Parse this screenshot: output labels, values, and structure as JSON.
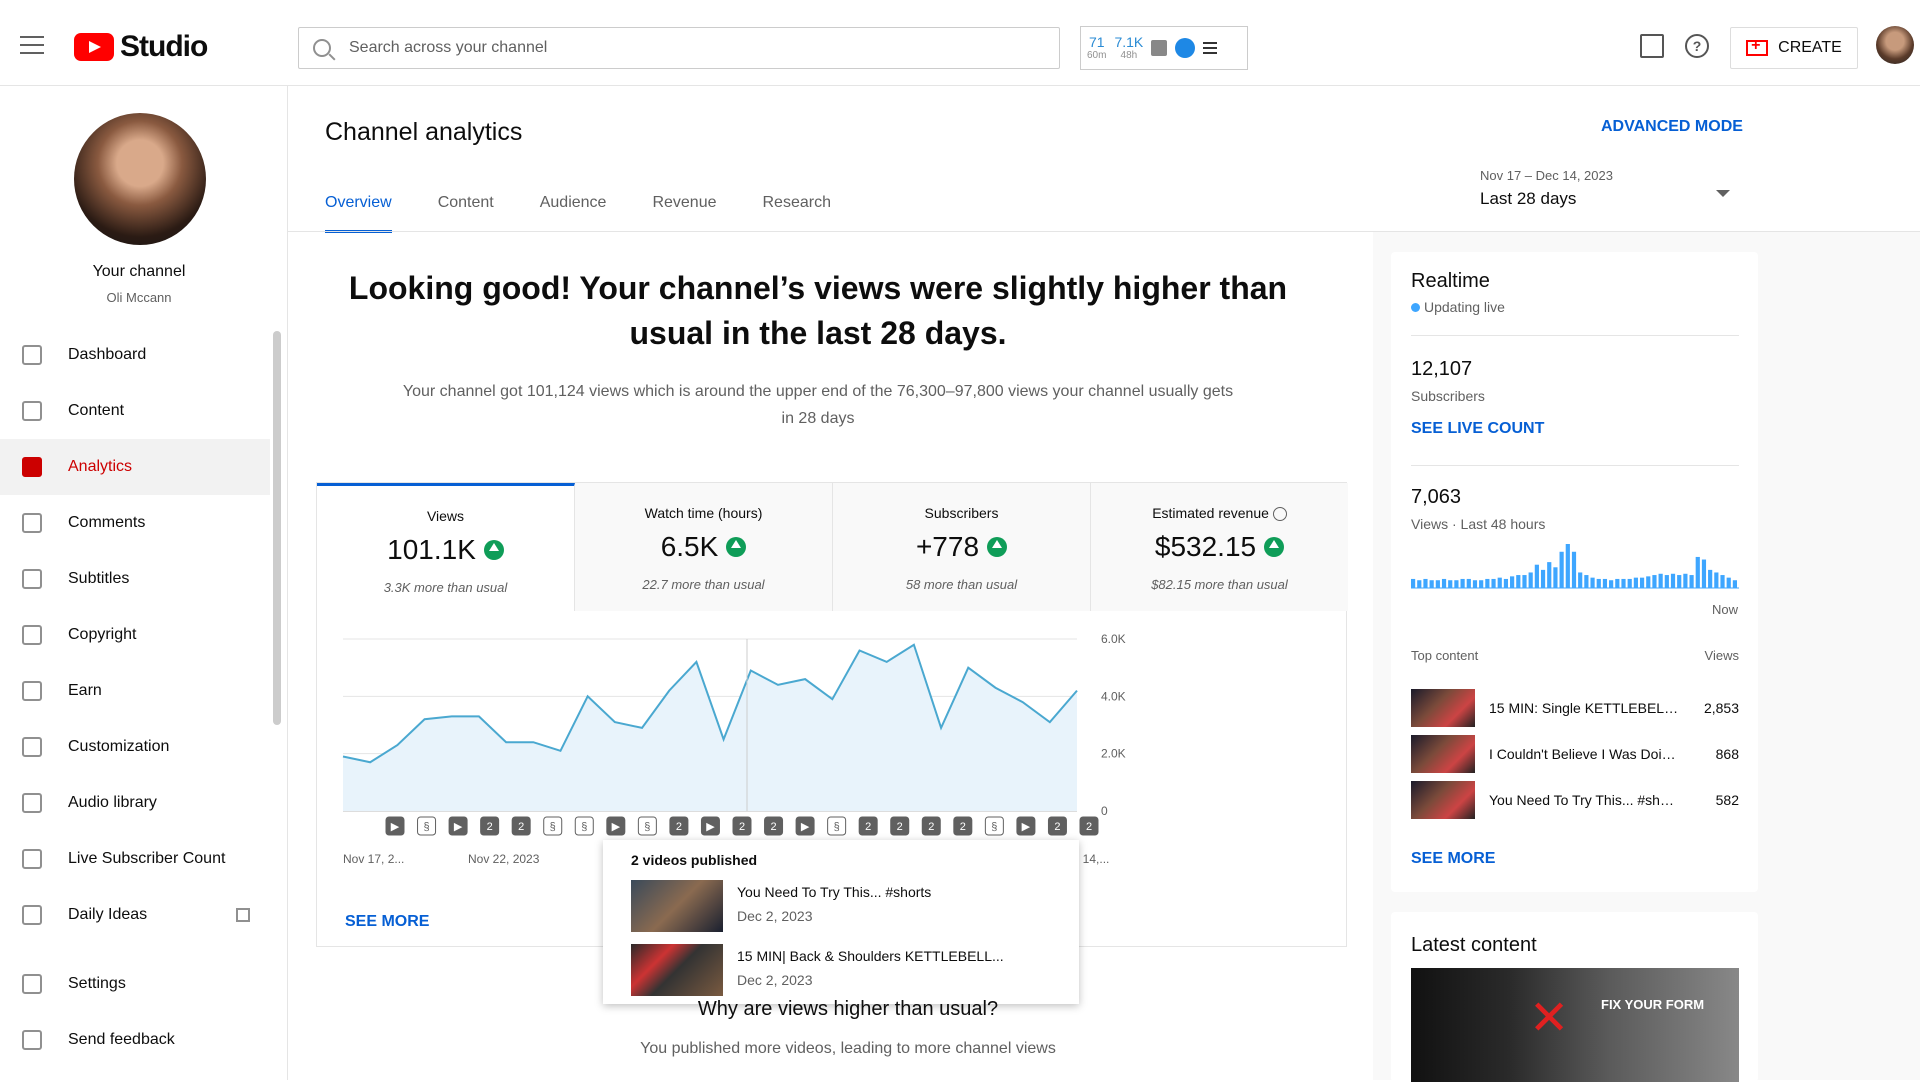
{
  "app": {
    "logo_text": "Studio",
    "brand_color": "#ff0000",
    "accent_color": "#065fd4"
  },
  "search": {
    "placeholder": "Search across your channel"
  },
  "stats_widget": {
    "a_value": "71",
    "a_sub": "60m",
    "b_value": "7.1K",
    "b_sub": "48h"
  },
  "header": {
    "create_label": "CREATE"
  },
  "channel": {
    "title": "Your channel",
    "name": "Oli Mccann"
  },
  "sidebar": {
    "items": [
      {
        "label": "Dashboard",
        "icon": "dashboard-icon"
      },
      {
        "label": "Content",
        "icon": "content-icon"
      },
      {
        "label": "Analytics",
        "icon": "analytics-icon",
        "active": true
      },
      {
        "label": "Comments",
        "icon": "comments-icon"
      },
      {
        "label": "Subtitles",
        "icon": "subtitles-icon"
      },
      {
        "label": "Copyright",
        "icon": "copyright-icon"
      },
      {
        "label": "Earn",
        "icon": "earn-icon"
      },
      {
        "label": "Customization",
        "icon": "customization-icon"
      },
      {
        "label": "Audio library",
        "icon": "audio-library-icon"
      },
      {
        "label": "Live Subscriber Count",
        "icon": "live-subscriber-icon"
      },
      {
        "label": "Daily Ideas",
        "icon": "daily-ideas-icon"
      }
    ],
    "settings_label": "Settings",
    "feedback_label": "Send feedback"
  },
  "page": {
    "title": "Channel analytics",
    "advanced_mode": "ADVANCED MODE"
  },
  "tabs": [
    "Overview",
    "Content",
    "Audience",
    "Revenue",
    "Research"
  ],
  "date_range": {
    "dates": "Nov 17 – Dec 14, 2023",
    "label": "Last 28 days"
  },
  "overview": {
    "headline": "Looking good! Your channel’s views were slightly higher than usual in the last 28 days.",
    "subline": "Your channel got 101,124 views which is around the upper end of the 76,300–97,800 views your channel usually gets in 28 days",
    "see_more": "SEE MORE",
    "why_title": "Why are views higher than usual?",
    "why_sub": "You published more videos, leading to more channel views"
  },
  "metrics": [
    {
      "label": "Views",
      "value": "101.1K",
      "note": "3.3K more than usual"
    },
    {
      "label": "Watch time (hours)",
      "value": "6.5K",
      "note": "22.7 more than usual"
    },
    {
      "label": "Subscribers",
      "value": "+778",
      "note": "58 more than usual"
    },
    {
      "label": "Estimated revenue",
      "value": "$532.15",
      "note": "$82.15 more than usual"
    }
  ],
  "chart_data": {
    "type": "area",
    "series": [
      {
        "values": [
          1900,
          1700,
          2300,
          3200,
          3300,
          3300,
          2400,
          2400,
          2100,
          4000,
          3100,
          2900,
          4200,
          5200,
          2500,
          4900,
          4400,
          4600,
          3900,
          5600,
          5200,
          5800,
          2900,
          5000,
          4300,
          3800,
          3100,
          4200
        ]
      }
    ],
    "x_tick_labels": [
      "Nov 17, 2...",
      "Nov 22, 2023",
      "",
      "",
      "",
      "c 10, 2023",
      "Dec 14,..."
    ],
    "y_ticks": [
      "0",
      "2.0K",
      "4.0K",
      "6.0K"
    ],
    "ylim": [
      0,
      6000
    ],
    "markers": [
      "video",
      "short",
      "video",
      "2",
      "2",
      "short",
      "short",
      "video",
      "short",
      "2",
      "video",
      "2",
      "2",
      "video",
      "short",
      "2",
      "2",
      "2",
      "2",
      "short",
      "video",
      "2",
      "2"
    ],
    "grid": true,
    "fill_color": "#e8f3fb",
    "line_color": "#4aa8d0"
  },
  "tooltip": {
    "title": "2 videos published",
    "videos": [
      {
        "title": "You Need To Try This... #shorts",
        "date": "Dec 2, 2023"
      },
      {
        "title": "15 MIN| Back & Shoulders KETTLEBELL...",
        "date": "Dec 2, 2023"
      }
    ]
  },
  "realtime": {
    "title": "Realtime",
    "live_label": "Updating live",
    "subscribers_value": "12,107",
    "subscribers_label": "Subscribers",
    "see_live_count": "SEE LIVE COUNT",
    "views_value": "7,063",
    "views_label": "Views · Last 48 hours",
    "now_label": "Now",
    "bars": [
      7,
      6,
      7,
      6,
      6,
      7,
      6,
      6,
      7,
      7,
      6,
      6,
      7,
      7,
      8,
      7,
      9,
      10,
      10,
      12,
      18,
      14,
      20,
      16,
      28,
      34,
      28,
      12,
      10,
      8,
      7,
      7,
      6,
      7,
      7,
      7,
      8,
      8,
      9,
      10,
      11,
      10,
      11,
      10,
      11,
      10,
      24,
      22,
      14,
      12,
      10,
      8,
      6
    ],
    "top_content_label": "Top content",
    "views_col_label": "Views",
    "top_content": [
      {
        "title": "15 MIN: Single KETTLEBELL...",
        "views": "2,853"
      },
      {
        "title": "I Couldn't Believe I Was Doing...",
        "views": "868"
      },
      {
        "title": "You Need To Try This... #shorts",
        "views": "582"
      }
    ],
    "see_more": "SEE MORE"
  },
  "latest_content": {
    "title": "Latest content",
    "thumb_text": "FIX YOUR FORM"
  }
}
